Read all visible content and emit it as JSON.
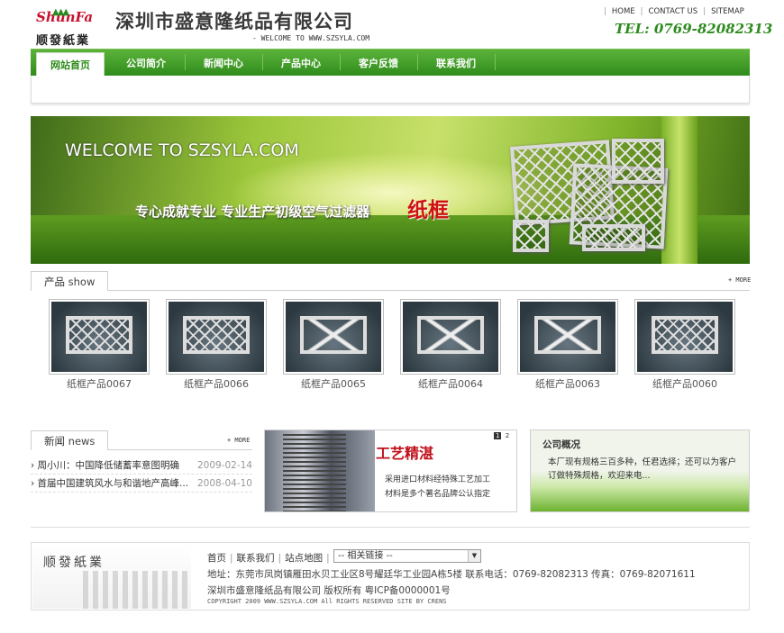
{
  "header": {
    "logo_script": "ShunFa",
    "logo_cn": "顺發紙業",
    "company_name": "深圳市盛意隆纸品有限公司",
    "welcome": "- WELCOME TO WWW.SZSYLA.COM",
    "toplinks": [
      "HOME",
      "CONTACT US",
      "SITEMAP"
    ],
    "tel": "TEL: 0769-82082313"
  },
  "nav": {
    "items": [
      "网站首页",
      "公司简介",
      "新闻中心",
      "产品中心",
      "客户反馈",
      "联系我们"
    ],
    "active": "网站首页"
  },
  "banner": {
    "welcome": "WELCOME TO SZSYLA.COM",
    "slogan": "专心成就专业  专业生产初级空气过滤器",
    "highlight": "纸框"
  },
  "products": {
    "heading_cn": "产品",
    "heading_en": "show",
    "more": "+ MORE",
    "items": [
      "纸框产品0067",
      "纸框产品0066",
      "纸框产品0065",
      "纸框产品0064",
      "纸框产品0063",
      "纸框产品0060"
    ]
  },
  "news": {
    "heading_cn": "新闻",
    "heading_en": "news",
    "more": "+ MORE",
    "items": [
      {
        "title": "周小川：中国降低储蓄率意图明确",
        "date": "2009-02-14"
      },
      {
        "title": "首届中国建筑风水与和谐地产高峰...",
        "date": "2008-04-10"
      }
    ]
  },
  "ad": {
    "title": "工艺精湛",
    "line1": "采用进口材料经特殊工艺加工",
    "line2": "材料是多个著名品牌公认指定",
    "pager": [
      "1",
      "2"
    ]
  },
  "company": {
    "title": "公司概况",
    "text": "本厂现有规格三百多种，任君选择；还可以为客户订做特殊规格，欢迎来电..."
  },
  "footer": {
    "logo_cn": "顺發紙業",
    "links": [
      "首页",
      "联系我们",
      "站点地图"
    ],
    "select_value": "--  相关链接  --",
    "address": "地址：东莞市凤岗镇雁田水贝工业区8号耀廷华工业园A栋5楼  联系电话：0769-82082313 传真：0769-82071611",
    "copyright": "深圳市盛意隆纸品有限公司 版权所有 粤ICP备0000001号",
    "small": "COPYRIGHT 2009 WWW.SZSYLA.COM All RIGHTS RESERVED     SITE BY CRENS"
  },
  "colors": {
    "brand_green": "#2f8c1c",
    "accent_red": "#c8102e"
  }
}
